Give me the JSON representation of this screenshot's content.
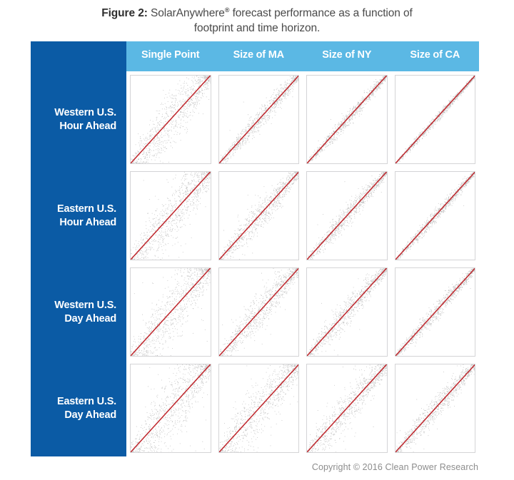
{
  "caption": {
    "prefix": "Figure 2:",
    "body_line1_a": " SolarAnywhere",
    "registered_mark": "®",
    "body_line1_b": " forecast performance as a function of",
    "body_line2": "footprint and time horizon."
  },
  "colors": {
    "sidebar_blue": "#0B5BA5",
    "header_blue": "#5BB8E4",
    "reference_line_red": "#C0272D",
    "point_gray": "#808080",
    "cell_border": "#d4d4d6",
    "caption_text": "#4a4a4a",
    "copyright_text": "#8d8d8d"
  },
  "columns": [
    {
      "label": "Single Point"
    },
    {
      "label": "Size of MA"
    },
    {
      "label": "Size of NY"
    },
    {
      "label": "Size of CA"
    }
  ],
  "rows": [
    {
      "line1": "Western U.S.",
      "line2": "Hour Ahead"
    },
    {
      "line1": "Eastern U.S.",
      "line2": "Hour Ahead"
    },
    {
      "line1": "Western U.S.",
      "line2": "Day Ahead"
    },
    {
      "line1": "Eastern U.S.",
      "line2": "Day Ahead"
    }
  ],
  "footer": {
    "copyright": "Copyright © 2016 Clean Power Research"
  },
  "chart_data": {
    "type": "scatter",
    "title": "SolarAnywhere® forecast performance as a function of footprint and time horizon.",
    "layout": "small-multiples matrix, 4 rows × 4 columns",
    "grid": false,
    "legend": null,
    "xlabel": "",
    "ylabel": "",
    "xlim": [
      0,
      1
    ],
    "ylim": [
      0,
      1
    ],
    "tick_labels_shown": false,
    "reference_line": {
      "name": "1:1 identity line",
      "color": "#C0272D",
      "slope": 1,
      "intercept": 0
    },
    "row_categories": [
      "Western U.S. Hour Ahead",
      "Eastern U.S. Hour Ahead",
      "Western U.S. Day Ahead",
      "Eastern U.S. Day Ahead"
    ],
    "column_categories": [
      "Single Point",
      "Size of MA",
      "Size of NY",
      "Size of CA"
    ],
    "point_color": "#808080",
    "points_per_panel": 900,
    "panels": [
      {
        "row": "Western U.S. Hour Ahead",
        "col": "Single Point",
        "scatter_spread": 0.115,
        "seed": 11
      },
      {
        "row": "Western U.S. Hour Ahead",
        "col": "Size of MA",
        "scatter_spread": 0.052,
        "seed": 12
      },
      {
        "row": "Western U.S. Hour Ahead",
        "col": "Size of NY",
        "scatter_spread": 0.034,
        "seed": 13
      },
      {
        "row": "Western U.S. Hour Ahead",
        "col": "Size of CA",
        "scatter_spread": 0.02,
        "seed": 14
      },
      {
        "row": "Eastern U.S. Hour Ahead",
        "col": "Single Point",
        "scatter_spread": 0.13,
        "seed": 21
      },
      {
        "row": "Eastern U.S. Hour Ahead",
        "col": "Size of MA",
        "scatter_spread": 0.072,
        "seed": 22
      },
      {
        "row": "Eastern U.S. Hour Ahead",
        "col": "Size of NY",
        "scatter_spread": 0.048,
        "seed": 23
      },
      {
        "row": "Eastern U.S. Hour Ahead",
        "col": "Size of CA",
        "scatter_spread": 0.03,
        "seed": 24
      },
      {
        "row": "Western U.S. Day Ahead",
        "col": "Single Point",
        "scatter_spread": 0.14,
        "seed": 31
      },
      {
        "row": "Western U.S. Day Ahead",
        "col": "Size of MA",
        "scatter_spread": 0.085,
        "seed": 32
      },
      {
        "row": "Western U.S. Day Ahead",
        "col": "Size of NY",
        "scatter_spread": 0.062,
        "seed": 33
      },
      {
        "row": "Western U.S. Day Ahead",
        "col": "Size of CA",
        "scatter_spread": 0.04,
        "seed": 34
      },
      {
        "row": "Eastern U.S. Day Ahead",
        "col": "Single Point",
        "scatter_spread": 0.165,
        "seed": 41
      },
      {
        "row": "Eastern U.S. Day Ahead",
        "col": "Size of MA",
        "scatter_spread": 0.12,
        "seed": 42
      },
      {
        "row": "Eastern U.S. Day Ahead",
        "col": "Size of NY",
        "scatter_spread": 0.092,
        "seed": 43
      },
      {
        "row": "Eastern U.S. Day Ahead",
        "col": "Size of CA",
        "scatter_spread": 0.058,
        "seed": 44
      }
    ]
  }
}
